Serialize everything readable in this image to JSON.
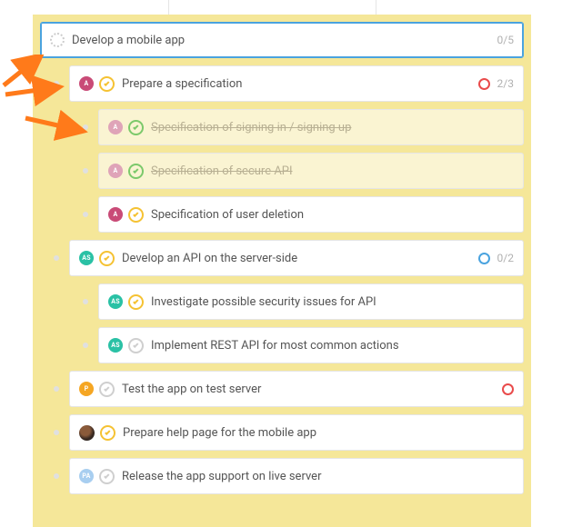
{
  "root": {
    "title": "Develop a mobile app",
    "count": "0/5"
  },
  "tasks": [
    {
      "title": "Prepare a specification",
      "assignee": "A",
      "assignee_color": "pink",
      "status": "amber",
      "priority": "red",
      "count": "2/3",
      "done": false,
      "indent": 1
    },
    {
      "title": "Specification of signing in / signing up",
      "assignee": "A",
      "assignee_color": "pink-faded",
      "status": "green",
      "done": true,
      "indent": 2
    },
    {
      "title": "Specification of secure API",
      "assignee": "A",
      "assignee_color": "pink-faded",
      "status": "green",
      "done": true,
      "indent": 2
    },
    {
      "title": "Specification of user deletion",
      "assignee": "A",
      "assignee_color": "pink",
      "status": "amber",
      "done": false,
      "indent": 2
    },
    {
      "title": "Develop an API on the server-side",
      "assignee": "AS",
      "assignee_color": "teal",
      "status": "amber",
      "priority": "blue",
      "count": "0/2",
      "done": false,
      "indent": 1
    },
    {
      "title": "Investigate possible security issues for API",
      "assignee": "AS",
      "assignee_color": "teal",
      "status": "amber",
      "done": false,
      "indent": 2
    },
    {
      "title": "Implement REST API for most common actions",
      "assignee": "AS",
      "assignee_color": "teal",
      "status": "grey",
      "done": false,
      "indent": 2
    },
    {
      "title": "Test the app on test server",
      "assignee": "P",
      "assignee_color": "orange",
      "status": "grey",
      "priority": "red",
      "done": false,
      "indent": 1
    },
    {
      "title": "Prepare help page for the mobile app",
      "assignee_img": true,
      "status": "amber",
      "done": false,
      "indent": 1
    },
    {
      "title": "Release the app support on live server",
      "assignee": "PA",
      "assignee_color": "blue-light",
      "status": "grey",
      "done": false,
      "indent": 1
    }
  ],
  "annotation": {
    "color": "#ff7a1a"
  }
}
